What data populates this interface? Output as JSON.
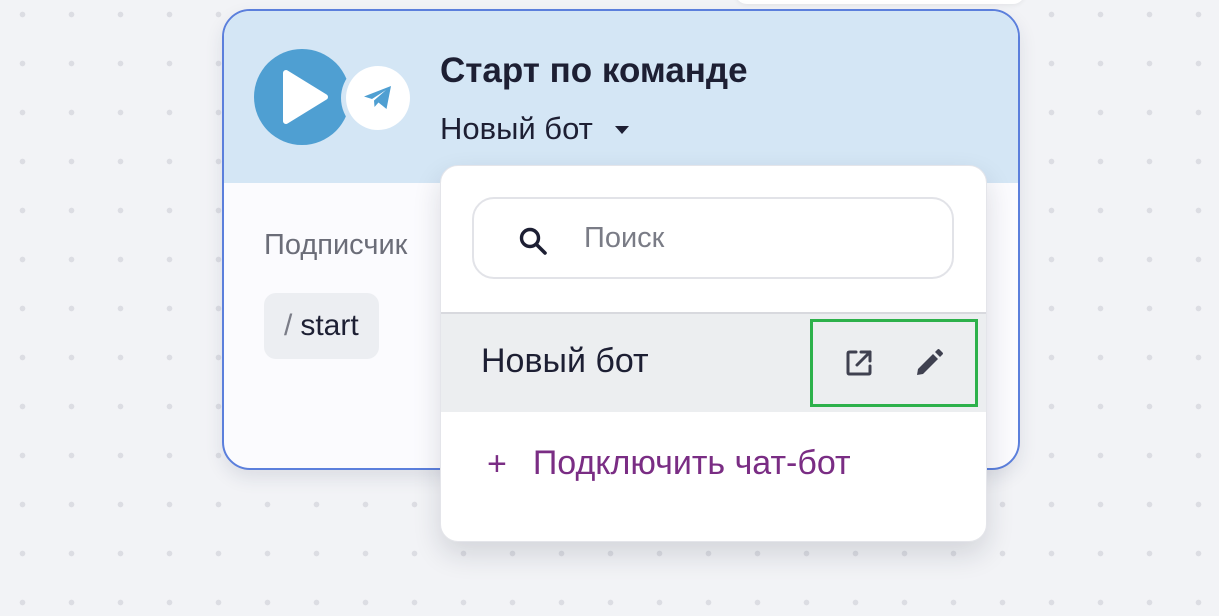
{
  "node": {
    "title": "Старт по команде",
    "bot_selector": {
      "selected_value": "Новый бот"
    },
    "subscriber_label": "Подписчик",
    "command": {
      "prefix": "/",
      "text": "start"
    }
  },
  "dropdown": {
    "search": {
      "placeholder": "Поиск",
      "value": ""
    },
    "items": [
      {
        "label": "Новый бот",
        "actions": [
          "external-link-icon",
          "pencil-icon"
        ]
      }
    ],
    "connect_action": {
      "icon": "+",
      "label": "Подключить чат-бот"
    }
  },
  "icons": {
    "trigger": "play-icon",
    "channel": "telegram-icon",
    "caret": "caret-down-icon",
    "search": "search-icon"
  },
  "colors": {
    "node_border": "#5b7fdc",
    "node_header_bg": "#d4e6f5",
    "play_icon_bg": "#4f9fd2",
    "accent_link": "#7a2d84",
    "highlight_box": "#2db14b",
    "selected_item_bg": "#eceef0"
  }
}
